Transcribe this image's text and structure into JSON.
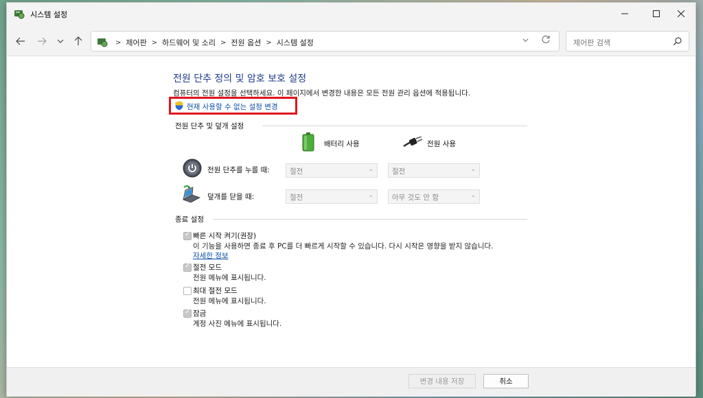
{
  "window": {
    "title": "시스템 설정"
  },
  "nav": {
    "breadcrumbs": [
      "제어판",
      "하드웨어 및 소리",
      "전원 옵션",
      "시스템 설정"
    ],
    "search_placeholder": "제어판 검색"
  },
  "page": {
    "title": "전원 단추 정의 및 암호 보호 설정",
    "description": "컴퓨터의 전원 설정을 선택하세요. 이 페이지에서 변경한 내용은 모든 전원 관리 옵션에 적용됩니다.",
    "change_link": "현재 사용할 수 없는 설정 변경"
  },
  "power_buttons": {
    "header": "전원 단추 및 덮개 설정",
    "col_battery": "배터리 사용",
    "col_plugged": "전원 사용",
    "rows": [
      {
        "label": "전원 단추를 누를 때:",
        "battery": "절전",
        "plugged": "절전",
        "icon": "power-button-icon"
      },
      {
        "label": "덮개를 닫을 때:",
        "battery": "절전",
        "plugged": "아무 것도 안 함",
        "icon": "laptop-lid-icon"
      }
    ]
  },
  "shutdown": {
    "header": "종료 설정",
    "options": [
      {
        "label": "빠른 시작 켜기(권장)",
        "checked": true,
        "desc": "이 기능을 사용하면 종료 후 PC를 더 빠르게 시작할 수 있습니다. 다시 시작은 영향을 받지 않습니다.",
        "link": "자세한 정보"
      },
      {
        "label": "절전 모드",
        "checked": true,
        "desc": "전원 메뉴에 표시됩니다."
      },
      {
        "label": "최대 절전 모드",
        "checked": false,
        "desc": "전원 메뉴에 표시됩니다."
      },
      {
        "label": "잠금",
        "checked": true,
        "desc": "계정 사진 메뉴에 표시됩니다."
      }
    ]
  },
  "footer": {
    "save_label": "변경 내용 저장",
    "cancel_label": "취소"
  },
  "colors": {
    "title_blue": "#1e3c8c",
    "link_blue": "#0a4fa8",
    "highlight_red": "#e0141c"
  }
}
